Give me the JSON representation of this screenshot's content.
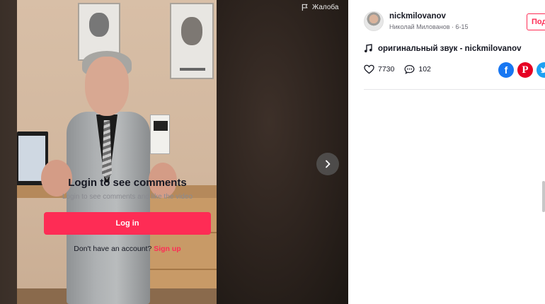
{
  "video": {
    "report_label": "Жалоба"
  },
  "author": {
    "username": "nickmilovanov",
    "display_name": "Николай Милованов",
    "separator": " · ",
    "date": "6-15"
  },
  "follow": {
    "label": "Подписаться"
  },
  "music": {
    "label": "оригинальный звук - nickmilovanov"
  },
  "stats": {
    "likes": "7730",
    "comments": "102"
  },
  "share": {
    "facebook_glyph": "f",
    "pinterest_glyph": "P"
  },
  "comments": {
    "title": "Login to see comments",
    "subtitle": "Login to see comments and like the video",
    "login_label": "Log in",
    "no_account_text": "Don't have an account? ",
    "signup_label": "Sign up"
  },
  "colors": {
    "accent": "#fe2c55",
    "facebook": "#1877f2",
    "pinterest": "#e60023",
    "twitter": "#1da1f2"
  }
}
